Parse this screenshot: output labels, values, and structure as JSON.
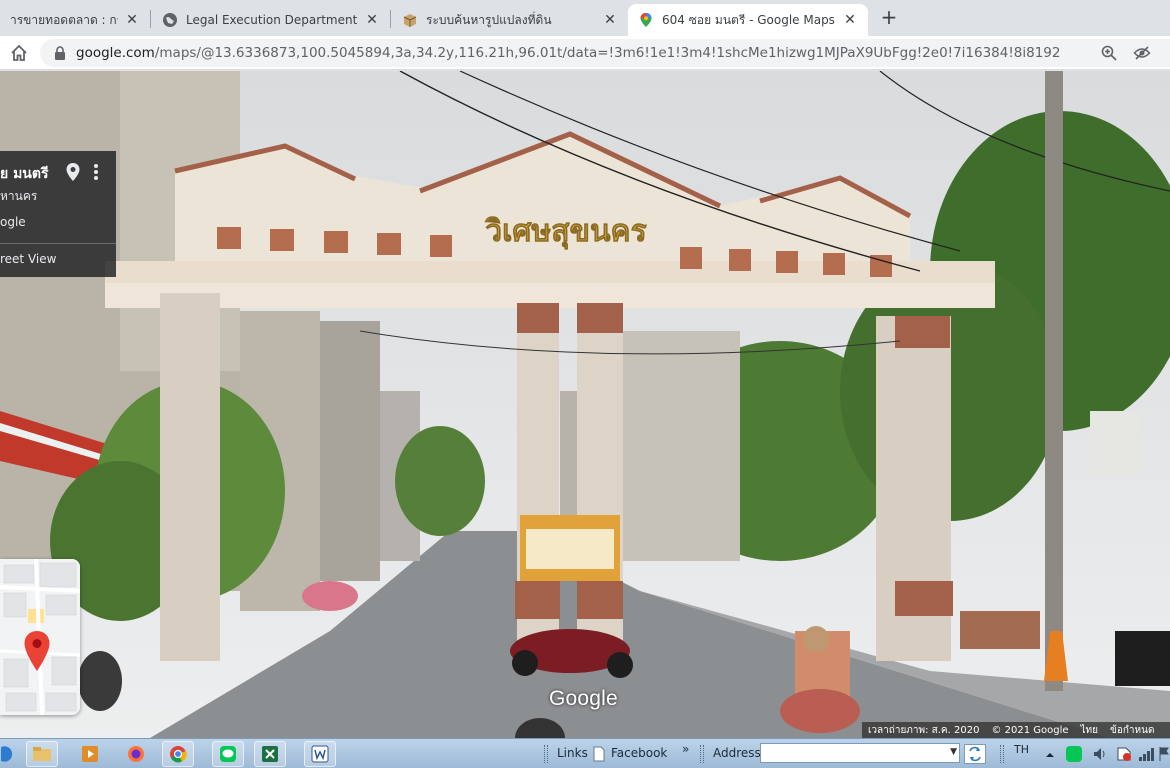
{
  "browser": {
    "tabs": [
      {
        "title": "ารขายทอดตลาด : กรมบังคั",
        "icon": "document-icon",
        "active": false
      },
      {
        "title": "Legal Execution Department.",
        "icon": "globe-icon",
        "active": false
      },
      {
        "title": "ระบบค้นหารูปแปลงที่ดิน",
        "icon": "package-icon",
        "active": false
      },
      {
        "title": "604 ซอย มนตรี - Google Maps",
        "icon": "maps-pin-icon",
        "active": true
      }
    ],
    "close_glyph": "✕",
    "new_tab_glyph": "+",
    "address": {
      "host": "google.com",
      "path": "/maps/@13.6336873,100.5045894,3a,34.2y,116.21h,96.01t/data=!3m6!1e1!3m4!1shcMe1hizwg1MJPaX9UbFgg!2e0!7i16384!8i8192"
    }
  },
  "streetview": {
    "place_name": "ย มนตรี",
    "city": "หานคร",
    "owner": "ogle",
    "mode_label": "reet View",
    "watermark": "Google",
    "sign_text": "วิเศษสุขนคร",
    "footer": {
      "capture_date": "เวลาถ่ายภาพ: ส.ค. 2020",
      "copyright": "© 2021 Google",
      "language": "ไทย",
      "terms": "ข้อกำหนด"
    }
  },
  "taskbar": {
    "links_label": "Links",
    "facebook_label": "Facebook",
    "chevron": "»",
    "address_label": "Address",
    "lang": "TH",
    "colors": {
      "accent": "#1a73e8",
      "pin": "#ea4335"
    }
  }
}
